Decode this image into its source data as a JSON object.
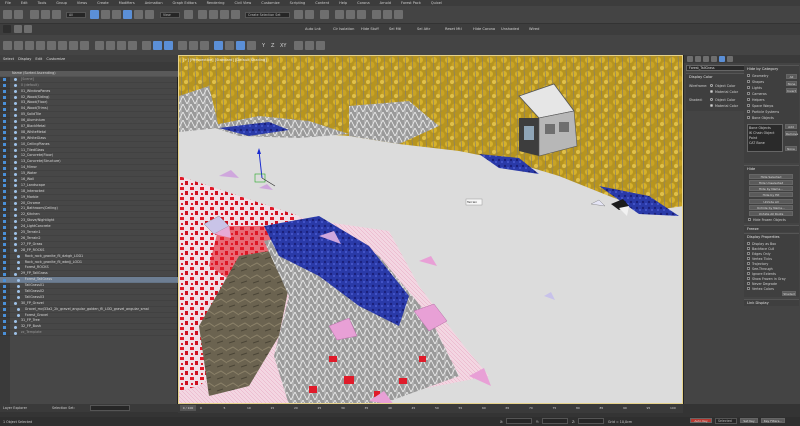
{
  "menubar": {
    "items": [
      "File",
      "Edit",
      "Tools",
      "Group",
      "Views",
      "Create",
      "Modifiers",
      "Animation",
      "Graph Editors",
      "Rendering",
      "Civil View",
      "Customize",
      "Scripting",
      "Content",
      "Help",
      "Corona",
      "Arnold",
      "Forest Pack",
      "Quixel"
    ]
  },
  "toolbar": {
    "selection_filter": "All",
    "view_mode": "View",
    "selection_set": "Create Selection Set"
  },
  "toolbar2": {
    "items": [
      "Auto Lnk",
      "Clr Isolation",
      "Hide Stuff",
      "Sel Mtl",
      "Sel Attr",
      "Reset Mtl",
      "Hide Corona",
      "Unshaded",
      "Wired"
    ]
  },
  "toolbar3": {
    "axis": [
      "Y",
      "Z",
      "XY"
    ]
  },
  "explorer": {
    "menu": [
      "Select",
      "Display",
      "Edit",
      "Customize"
    ],
    "rows": [
      {
        "label": "Name (Sorted Ascending)",
        "indent": 0,
        "state": "header"
      },
      {
        "label": "[Scene]",
        "indent": 3,
        "state": "dim"
      },
      {
        "label": "0 (default)",
        "indent": 3,
        "state": "dim"
      },
      {
        "label": "01_WindowPanes",
        "indent": 3,
        "state": "normal"
      },
      {
        "label": "02_Wood(Siding)",
        "indent": 3,
        "state": "normal"
      },
      {
        "label": "03_Wood(Floor)",
        "indent": 3,
        "state": "normal"
      },
      {
        "label": "04_Wood(Trims)",
        "indent": 3,
        "state": "normal"
      },
      {
        "label": "05_SolidTile",
        "indent": 3,
        "state": "normal"
      },
      {
        "label": "06_Aluminium",
        "indent": 3,
        "state": "normal"
      },
      {
        "label": "07_BlackMetal",
        "indent": 3,
        "state": "normal"
      },
      {
        "label": "08_WhiteMetal",
        "indent": 3,
        "state": "normal"
      },
      {
        "label": "09_WhiteGlass",
        "indent": 3,
        "state": "normal"
      },
      {
        "label": "10_CeilingPlanes",
        "indent": 3,
        "state": "normal"
      },
      {
        "label": "11_TiledGlass",
        "indent": 3,
        "state": "normal"
      },
      {
        "label": "12_Concrete(Floor)",
        "indent": 3,
        "state": "normal"
      },
      {
        "label": "13_Concrete(Structure)",
        "indent": 3,
        "state": "normal"
      },
      {
        "label": "14_Mirror",
        "indent": 3,
        "state": "normal"
      },
      {
        "label": "15_Water",
        "indent": 3,
        "state": "normal"
      },
      {
        "label": "16_Wall",
        "indent": 3,
        "state": "normal"
      },
      {
        "label": "17_Landscape",
        "indent": 3,
        "state": "normal"
      },
      {
        "label": "18_Interacted",
        "indent": 3,
        "state": "normal"
      },
      {
        "label": "19_Marble",
        "indent": 3,
        "state": "normal"
      },
      {
        "label": "20_Chrome",
        "indent": 3,
        "state": "normal"
      },
      {
        "label": "21_Bathroom(Ceiling)",
        "indent": 3,
        "state": "normal"
      },
      {
        "label": "22_Kitchen",
        "indent": 3,
        "state": "normal"
      },
      {
        "label": "23_Stove/Nightlight",
        "indent": 3,
        "state": "normal"
      },
      {
        "label": "24_LightConcrete",
        "indent": 3,
        "state": "normal"
      },
      {
        "label": "25_Terrain1",
        "indent": 3,
        "state": "normal"
      },
      {
        "label": "26_Terrain2",
        "indent": 3,
        "state": "normal"
      },
      {
        "label": "27_FP_Grass",
        "indent": 3,
        "state": "normal"
      },
      {
        "label": "28_FP_ROCKS",
        "indent": 3,
        "state": "normal"
      },
      {
        "label": "Rock_rock_granite_fll_dzkgh_LOD1",
        "indent": 6,
        "state": "normal"
      },
      {
        "label": "Rock_rock_granite_fll_wbnjj_LOD1",
        "indent": 6,
        "state": "normal"
      },
      {
        "label": "Forest_ROCKS",
        "indent": 6,
        "state": "normal"
      },
      {
        "label": "29_FP_TallGrass",
        "indent": 3,
        "state": "normal"
      },
      {
        "label": "Forest_TallGrass",
        "indent": 6,
        "state": "selected"
      },
      {
        "label": "TallGrass01",
        "indent": 6,
        "state": "normal"
      },
      {
        "label": "TallGrass02",
        "indent": 6,
        "state": "normal"
      },
      {
        "label": "TallGrass03",
        "indent": 6,
        "state": "normal"
      },
      {
        "label": "30_FP_Gravel",
        "indent": 3,
        "state": "normal"
      },
      {
        "label": "Gravel_mvj33a2_2k_gravel_angular_golden_fll_LOD_gravel_angular_smal",
        "indent": 6,
        "state": "normal"
      },
      {
        "label": "Forest_Gravel",
        "indent": 6,
        "state": "normal"
      },
      {
        "label": "31_FP_Tree",
        "indent": 3,
        "state": "normal"
      },
      {
        "label": "32_FP_Bush",
        "indent": 3,
        "state": "normal"
      },
      {
        "label": "zz_Template",
        "indent": 3,
        "state": "dim"
      }
    ]
  },
  "viewport": {
    "label": "[+] [Perspective] [Standard] [Default Shading]",
    "tooltip": "Terrain"
  },
  "command_panel": {
    "object_name": "Forest_TallGrass",
    "display_color_title": "Display Color",
    "wireframe_label": "Wireframe:",
    "shaded_label": "Shaded:",
    "object_color": "Object Color",
    "material_color": "Material Color",
    "hide_by_category_title": "Hide by Category",
    "categories": [
      "Geometry",
      "Shapes",
      "Lights",
      "Cameras",
      "Helpers",
      "Space Warps",
      "Particle Systems",
      "Bone Objects"
    ],
    "cat_buttons": [
      "All",
      "None",
      "Invert"
    ],
    "list_items": [
      "Bone Objects",
      "IK Chain Object",
      "Point",
      "CAT Bone"
    ],
    "list_buttons": [
      "Add",
      "Remove",
      "None"
    ],
    "hide_title": "Hide",
    "hide_buttons": [
      "Hide Selected",
      "Hide Unselected",
      "Hide by Name...",
      "Hide by Hit"
    ],
    "unhide_buttons": [
      "Unhide All",
      "Unhide by Name...",
      "Unhide All Roots"
    ],
    "hide_frozen": "Hide Frozen Objects",
    "freeze_title": "Freeze",
    "display_props_title": "Display Properties",
    "display_props": [
      "Display as Box",
      "Backface Cull",
      "Edges Only",
      "Vertex Ticks",
      "Trajectory",
      "See-Through",
      "Ignore Extents",
      "Show Frozen in Gray",
      "Never Degrade",
      "Vertex Colors"
    ],
    "shaded_btn": "Shaded",
    "link_display_title": "Link Display"
  },
  "timeline": {
    "frame": "0 / 100",
    "ticks": [
      "0",
      "5",
      "10",
      "15",
      "20",
      "25",
      "30",
      "35",
      "40",
      "45",
      "50",
      "55",
      "60",
      "65",
      "70",
      "75",
      "80",
      "85",
      "90",
      "95",
      "100"
    ]
  },
  "status": {
    "layer_explorer": "Layer Explorer",
    "selection_set_label": "Selection Set:",
    "objects_selected": "1 Object Selected",
    "x_label": "X:",
    "y_label": "Y:",
    "z_label": "Z:",
    "grid": "Grid = 10,0cm",
    "auto_key": "Auto Key",
    "set_key": "Set Key",
    "selected": "Selected",
    "key_filters": "Key Filters..."
  },
  "colors": {
    "panel_bg": "#444444",
    "viewport_bg": "#d9d9d9",
    "selection": "#6d7e93",
    "accent_blue": "#5b8fd6"
  }
}
